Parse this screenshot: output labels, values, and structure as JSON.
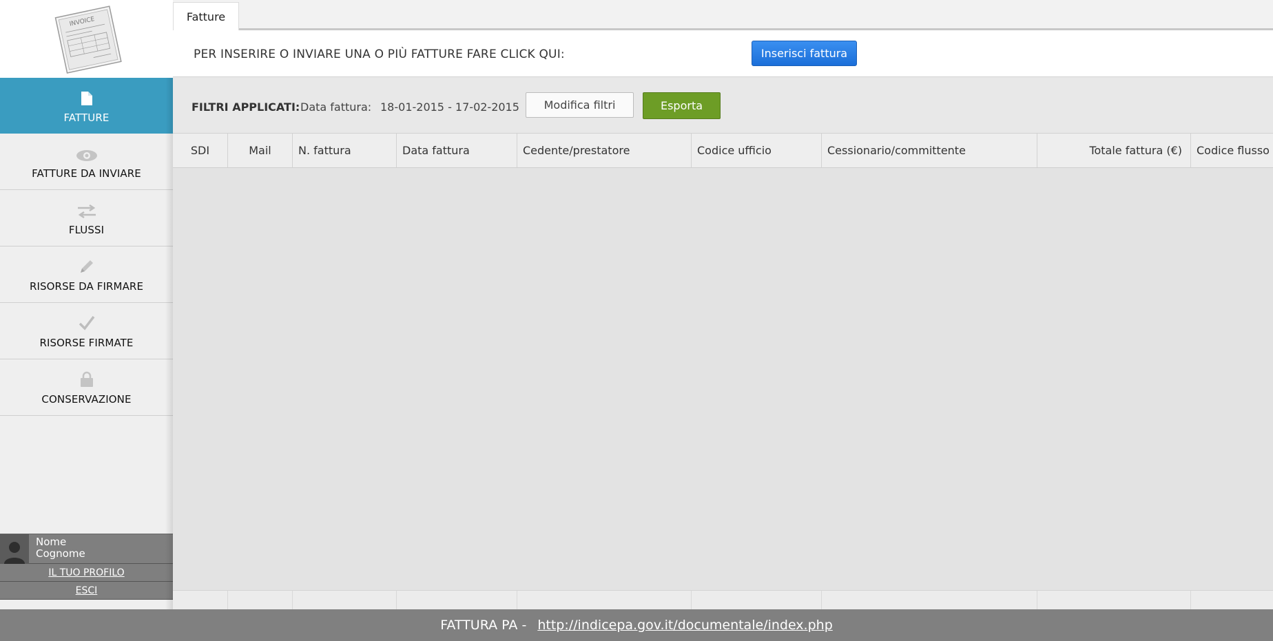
{
  "sidebar": {
    "logo_icon": "invoice-icon",
    "items": [
      {
        "label": "FATTURE",
        "icon": "document-icon",
        "active": true
      },
      {
        "label": "FATTURE DA INVIARE",
        "icon": "eye-icon",
        "active": false
      },
      {
        "label": "FLUSSI",
        "icon": "arrows-icon",
        "active": false
      },
      {
        "label": "RISORSE DA FIRMARE",
        "icon": "pencil-icon",
        "active": false
      },
      {
        "label": "RISORSE FIRMATE",
        "icon": "checkmark-icon",
        "active": false
      },
      {
        "label": "CONSERVAZIONE",
        "icon": "lock-icon",
        "active": false
      }
    ],
    "user": {
      "first_name": "Nome",
      "last_name": "Cognome",
      "profile_link": "IL TUO PROFILO",
      "logout_link": "ESCI"
    }
  },
  "tabs": [
    {
      "label": "Fatture"
    }
  ],
  "insert_bar": {
    "text": "PER INSERIRE O INVIARE UNA O PIÙ FATTURE FARE CLICK QUI:",
    "button_label": "Inserisci fattura"
  },
  "filters": {
    "label": "FILTRI APPLICATI:",
    "field": "Data fattura:",
    "value": "18-01-2015 - 17-02-2015",
    "modify_label": "Modifica filtri",
    "export_label": "Esporta"
  },
  "table": {
    "columns": [
      "SDI",
      "Mail",
      "N. fattura",
      "Data fattura",
      "Cedente/prestatore",
      "Codice ufficio",
      "Cessionario/committente",
      "Totale fattura (€)",
      "Codice flusso"
    ],
    "rows": []
  },
  "footer": {
    "label": "FATTURA PA -",
    "link": "http://indicepa.gov.it/documentale/index.php"
  },
  "colors": {
    "active_nav": "#3a9cc0",
    "primary_button": "#2a7fe6",
    "export_button": "#6d9d26",
    "footer": "#808080"
  }
}
